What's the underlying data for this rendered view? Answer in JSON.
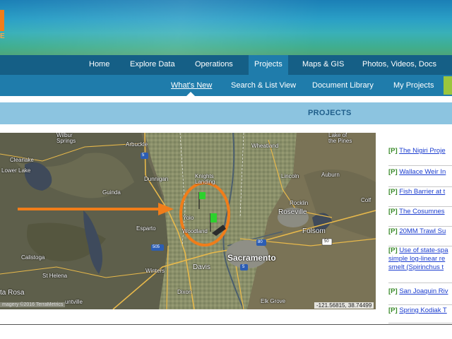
{
  "brand": {
    "colors": {
      "banner_top": "#1b7fb6",
      "nav_primary": "#155f86",
      "nav_secondary": "#1f7cab",
      "accent_orange": "#f07d1a",
      "projects_bar": "#8cc4e0",
      "accent_green": "#9bc53d"
    }
  },
  "nav_primary": {
    "items": [
      {
        "label": "Home"
      },
      {
        "label": "Explore Data"
      },
      {
        "label": "Operations"
      },
      {
        "label": "Projects",
        "active": true
      },
      {
        "label": "Maps & GIS"
      },
      {
        "label": "Photos, Videos, Docs"
      }
    ]
  },
  "nav_secondary": {
    "items": [
      {
        "label": "What's New",
        "current": true
      },
      {
        "label": "Search & List View"
      },
      {
        "label": "Document Library"
      },
      {
        "label": "My Projects"
      }
    ]
  },
  "projects_bar": {
    "title": "PROJECTS"
  },
  "map": {
    "places": {
      "wilbur_springs": "Wilbur\nSprings",
      "arbuckle": "Arbuckle",
      "wheatland": "Wheatland",
      "lake_of_the_pines": "Lake of\nthe Pines",
      "clearlake": "Clearlake",
      "lower_lake": "Lower Lake",
      "dunnigan": "Dunnigan",
      "lincoln": "Lincoln",
      "auburn": "Auburn",
      "guinda": "Guinda",
      "knights_landing": "Knights\nLanding",
      "rocklin": "Rocklin",
      "roseville": "Roseville",
      "colfax": "Colf",
      "esparto": "Esparto",
      "yolo": "Yolo",
      "woodland": "Woodland",
      "folsom": "Folsom",
      "sacramento": "Sacramento",
      "calistoga": "Calistoga",
      "winters": "Winters",
      "davis": "Davis",
      "st_helena": "St Helena",
      "santa_rosa": "ta Rosa",
      "yountville": "untville",
      "dixon": "Dixon",
      "elk_grove": "Elk Grove"
    },
    "shields": {
      "i5_north": "5",
      "i5_south": "5",
      "i80": "80",
      "i505": "505",
      "us50": "50"
    },
    "attribution": "magery ©2016 TerraMetrics",
    "coordinates": "-121.56815, 38.74499",
    "highlight_marker": "orange-circle-and-arrow",
    "project_markers": 2
  },
  "project_list": [
    {
      "tag": "[P]",
      "title": "The Nigiri Proje"
    },
    {
      "tag": "[P]",
      "title": "Wallace Weir In"
    },
    {
      "tag": "[P]",
      "title": "Fish Barrier at t"
    },
    {
      "tag": "[P]",
      "title": "The Cosumnes"
    },
    {
      "tag": "[P]",
      "title": "20MM Trawl Su"
    },
    {
      "tag": "[P]",
      "title": "Use of state-spa",
      "line2": "simple log-linear re",
      "line3": "smelt (Spirinchus t"
    },
    {
      "tag": "[P]",
      "title": "San Joaquin Riv"
    },
    {
      "tag": "[P]",
      "title": "Spring Kodiak T"
    }
  ]
}
